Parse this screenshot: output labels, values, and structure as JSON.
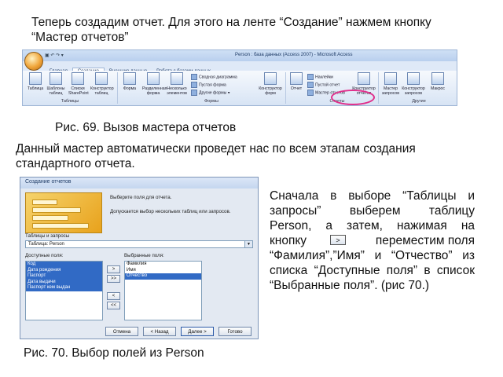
{
  "intro": {
    "line1": "Теперь создадим отчет. Для этого на ленте “Создание” нажмем кнопку",
    "line2": "“Мастер отчетов”"
  },
  "ribbon": {
    "window_title": "Person : база данных (Access 2007) - Microsoft Access",
    "tabs": [
      "Главная",
      "Создание",
      "Внешние данные",
      "Работа с базами данных"
    ],
    "active_tab": "Создание",
    "tables_buttons": [
      "Таблица",
      "Шаблоны таблиц",
      "Списки SharePoint",
      "Конструктор таблиц"
    ],
    "forms_buttons": [
      "Форма",
      "Разделенная форма",
      "Несколько элементов"
    ],
    "forms_small": [
      "Сводная диаграмма",
      "Пустая форма",
      "Другие формы"
    ],
    "forms_designer": "Конструктор форм",
    "reports_big": "Отчет",
    "reports_small": [
      "Наклейки",
      "Пустой отчет",
      "Мастер отчетов"
    ],
    "reports_designer": "Конструктор отчетов",
    "other_buttons": [
      "Мастер запросов",
      "Конструктор запросов",
      "Макрос"
    ],
    "groups": [
      "Таблицы",
      "Формы",
      "Отчеты",
      "Другие"
    ]
  },
  "caption1": "Рис. 69. Вызов мастера отчетов",
  "para": {
    "line1": "Данный мастер автоматически проведет нас по всем этапам создания",
    "line2": "стандартного отчета."
  },
  "dialog": {
    "title": "Создание отчетов",
    "prompt": "Выберите поля для отчета.",
    "hint": "Допускается выбор нескольких таблиц или запросов.",
    "tables_label": "Таблицы и запросы",
    "tables_value": "Таблица: Person",
    "available_label": "Доступные поля:",
    "available": [
      "Код",
      "Дата рождения",
      "Паспорт",
      "Дата выдачи",
      "Паспорт кем выдан"
    ],
    "selected_label": "Выбранные поля:",
    "selected": [
      "Фамилия",
      "Имя",
      "Отчество"
    ],
    "move_buttons": [
      ">",
      ">>",
      "<",
      "<<"
    ],
    "buttons": [
      "Отмена",
      "< Назад",
      "Далее >",
      "Готово"
    ]
  },
  "side_text": {
    "lines": [
      "Сначала в выборе “Таблицы и",
      "запросы” выберем таблицу",
      "Person, а затем, нажимая на",
      "кнопку",
      "переместим поля",
      "“Фамилия”,”Имя” и “Отчество” из",
      "списка “Доступные поля” в список",
      "“Выбранные поля”. (рис 70.)"
    ],
    "inline_button": ">"
  },
  "caption2": "Рис. 70. Выбор полей из Person"
}
